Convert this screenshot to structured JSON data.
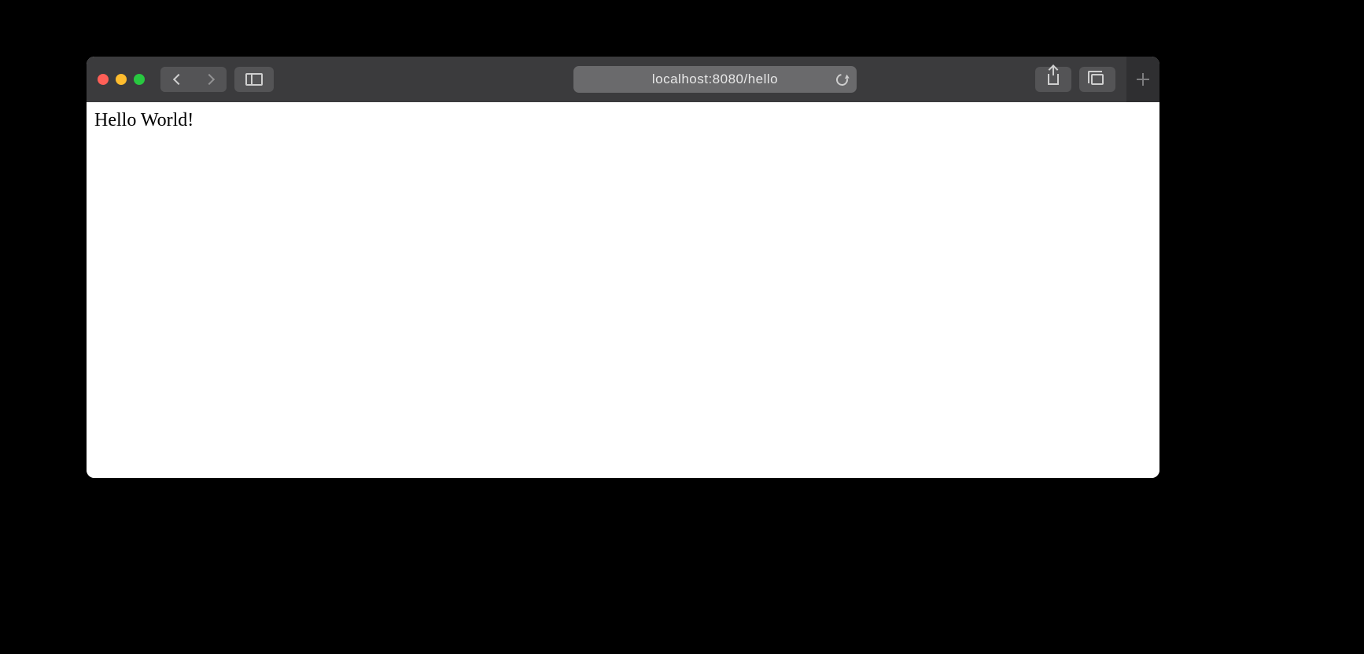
{
  "browser": {
    "address_url": "localhost:8080/hello"
  },
  "page": {
    "body_text": "Hello World!"
  }
}
